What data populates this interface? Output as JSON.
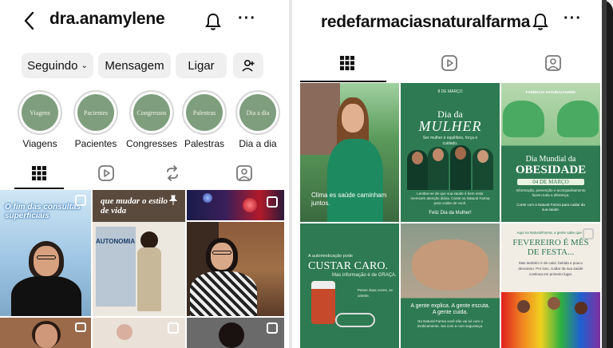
{
  "left": {
    "username": "dra.anamylene",
    "buttons": {
      "follow": "Seguindo",
      "message": "Mensagem",
      "call": "Ligar"
    },
    "highlights": [
      {
        "label": "Viagens",
        "cover": "Viagens"
      },
      {
        "label": "Pacientes",
        "cover": "Pacientes"
      },
      {
        "label": "Congresses",
        "cover": "Congressos"
      },
      {
        "label": "Palestras",
        "cover": "Palestras"
      },
      {
        "label": "Dia a dia",
        "cover": "Dia a dia"
      }
    ],
    "posts": [
      {
        "caption": "O fim das consultas superficiais"
      },
      {
        "caption": "que mudar o estilo de vida",
        "slide": "AUTONOMIA"
      },
      {
        "caption": ""
      },
      {
        "caption": ""
      },
      {
        "caption": ""
      },
      {
        "caption": ""
      }
    ]
  },
  "right": {
    "username": "redefarmaciasnaturalfarma",
    "posts": [
      {
        "caption": "Clima es saúde caminham juntos."
      },
      {
        "tag": "8 DE MARÇO",
        "title_1": "Dia da",
        "title_2": "MULHER",
        "body": "Ser mulher é equilíbrio, força e cuidado.",
        "footer": "Lembre-se de que sua saúde é bem estar merecem atenção diária. Conte na Natural Farma para cuidar de você.",
        "signoff": "Feliz Dia da Mulher!"
      },
      {
        "brand": "FARMÁCIA NATURALFARMA",
        "title_1": "Dia Mundial da",
        "title_2": "OBESIDADE",
        "date": "04 DE MARÇO",
        "body": "Informação, prevenção e acompanhamento fazem toda a diferença.",
        "cta": "Conte com a Natural Farma para cuidar da sua saúde."
      },
      {
        "kicker": "A automedicação pode",
        "title": "CUSTAR CARO.",
        "sub": "Mas informação é de GRAÇA.",
        "note": "Pense duas vezes, se oriente."
      },
      {
        "line1": "A gente explica. A gente escuta. A gente cuida.",
        "line2": "Na Natural Farma você não vai só com o medicamento. Sai com a com segurança."
      },
      {
        "kicker": "Aqui na NaturalFarma, a gente sabe que...",
        "title": "FEVEREIRO É MÊS DE FESTA...",
        "body": "Mas também é de calor, bebida e pouco descanso. Por isso, cuidar da sua saúde continua em primeiro lugar."
      }
    ]
  },
  "colors": {
    "green_dark": "#1f6b45",
    "green_mid": "#2f7d55",
    "highlight_green": "#7e9e7e"
  }
}
